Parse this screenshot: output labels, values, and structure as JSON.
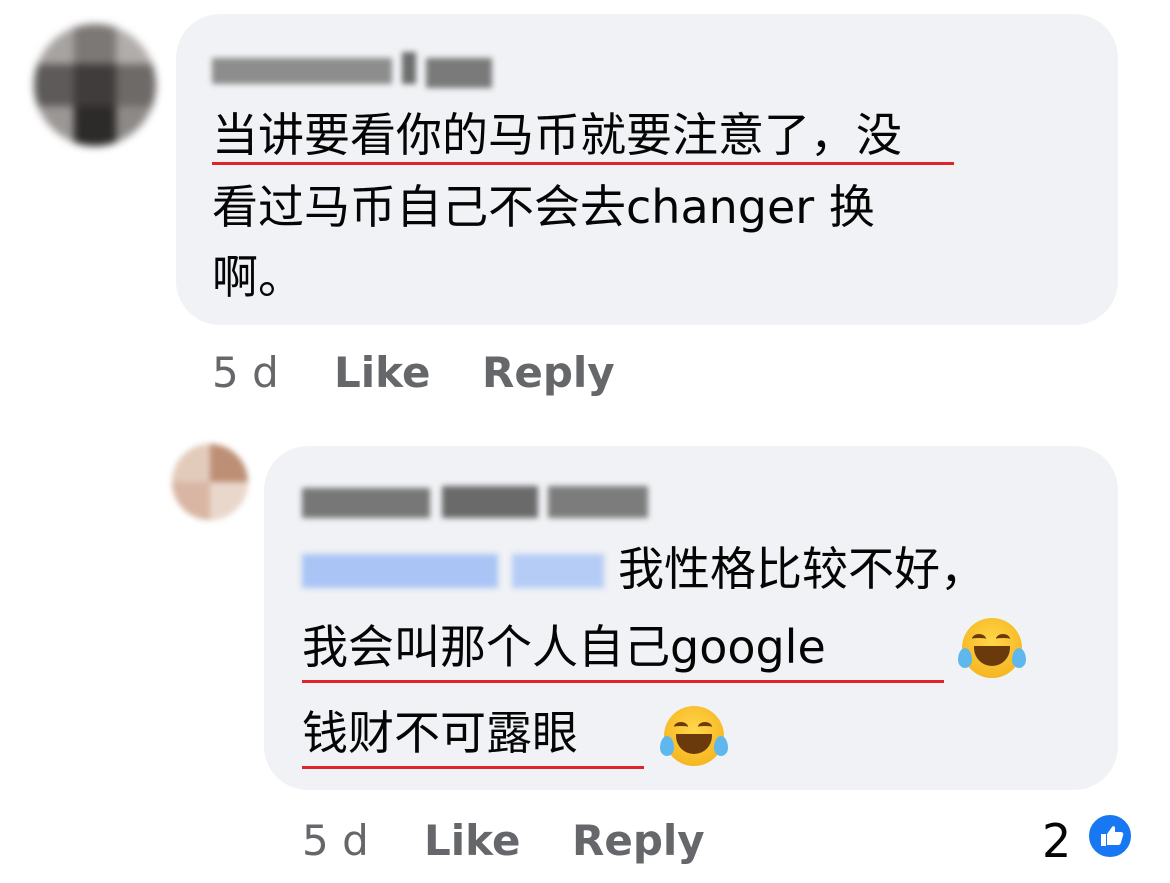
{
  "comment1": {
    "author_redacted": true,
    "text_lines": [
      "当讲要看你的马币就要注意了，没",
      "看过马币自己不会去changer 换",
      "啊。"
    ],
    "time": "5 d",
    "like_label": "Like",
    "reply_label": "Reply"
  },
  "comment2": {
    "author_redacted": true,
    "mention_redacted": true,
    "text_line1": "我性格比较不好，",
    "text_line2": "我会叫那个人自己google",
    "text_line3": "钱财不可露眼",
    "emoji": "tears-of-joy",
    "time": "5 d",
    "like_label": "Like",
    "reply_label": "Reply",
    "reaction_count": "2",
    "reaction_icon": "like-icon"
  },
  "colors": {
    "bubble": "#f0f2f5",
    "meta": "#65676b",
    "underline": "#e0242b",
    "mention_blur": "#a9c4f5",
    "like_blue": "#1877f2"
  }
}
